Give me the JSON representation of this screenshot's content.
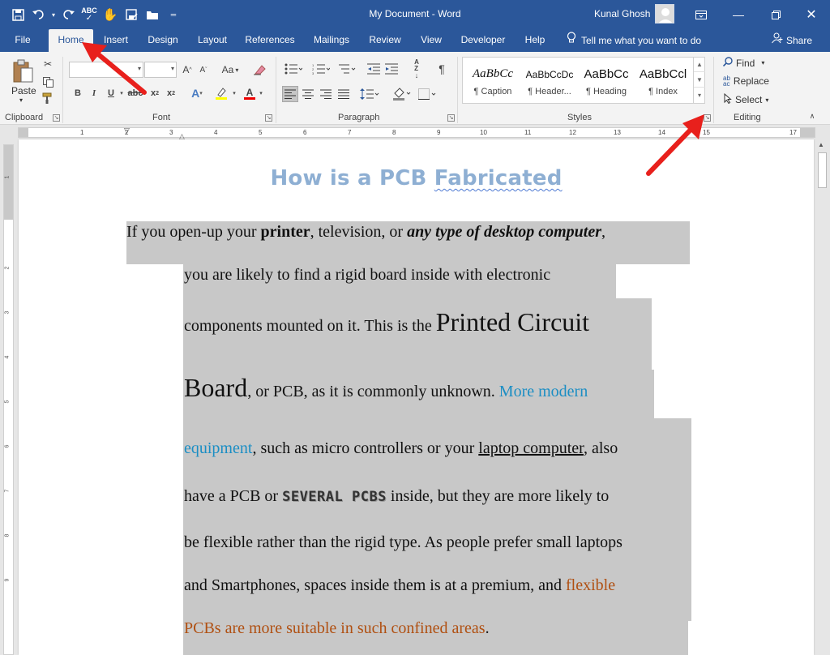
{
  "window": {
    "title": "My Document  -  Word",
    "user": "Kunal Ghosh"
  },
  "tabs": [
    "File",
    "Home",
    "Insert",
    "Design",
    "Layout",
    "References",
    "Mailings",
    "Review",
    "View",
    "Developer",
    "Help"
  ],
  "tell_me": "Tell me what you want to do",
  "share": "Share",
  "ribbon": {
    "clipboard": {
      "label": "Clipboard",
      "paste": "Paste"
    },
    "font": {
      "label": "Font",
      "case_btn": "Aa"
    },
    "paragraph": {
      "label": "Paragraph"
    },
    "styles": {
      "label": "Styles",
      "items": [
        {
          "sample": "AaBbCc",
          "name": "¶ Caption"
        },
        {
          "sample": "AaBbCcDc",
          "name": "¶ Header..."
        },
        {
          "sample": "AaBbCc",
          "name": "¶ Heading"
        },
        {
          "sample": "AaBbCcl",
          "name": "¶ Index"
        }
      ]
    },
    "editing": {
      "label": "Editing",
      "find": "Find",
      "replace": "Replace",
      "select": "Select"
    }
  },
  "ruler": {
    "numbers": [
      "1",
      "2",
      "3",
      "4",
      "5",
      "6",
      "7",
      "8",
      "9",
      "10",
      "11",
      "12",
      "13",
      "14",
      "15",
      "17"
    ],
    "vertical_numbers": [
      "1",
      "2",
      "3",
      "4",
      "5",
      "6",
      "7",
      "8",
      "9"
    ]
  },
  "document": {
    "heading_pre": "How is a PCB ",
    "heading_misspelled": "Fabricated",
    "l1_a": "If you open-up your ",
    "l1_b": "printer",
    "l1_c": ", television, or ",
    "l1_d": "any type of desktop computer",
    "l1_e": ",",
    "l2": "you are likely to find a rigid board inside with electronic",
    "l3_a": "components mounted on it. This is the ",
    "l3_b": "Printed Circuit",
    "l4_a": "Board",
    "l4_b": ", or PCB, as it is commonly unknown. ",
    "l4_c": "More modern",
    "l5_a": "equipment",
    "l5_b": ", such as micro controllers or your ",
    "l5_c": "laptop computer",
    "l5_d": ", also",
    "l6_a": "have a PCB or ",
    "l6_b": "SEVERAL PCBS",
    "l6_c": " inside, but they are more likely to",
    "l7": "be flexible rather than the rigid type. As people prefer small laptops",
    "l8_a": "and Smartphones, spaces inside them is at a premium, and ",
    "l8_b": "flexible",
    "l9_a": "PCBs are more suitable in such confined areas",
    "l9_b": "."
  },
  "colors": {
    "accent": "#2b579a",
    "heading": "#8eafd3",
    "highlight": "#c8c8c8",
    "blue_text": "#1b8ec4",
    "orange_text": "#b05012",
    "arrow": "#e8201c"
  }
}
